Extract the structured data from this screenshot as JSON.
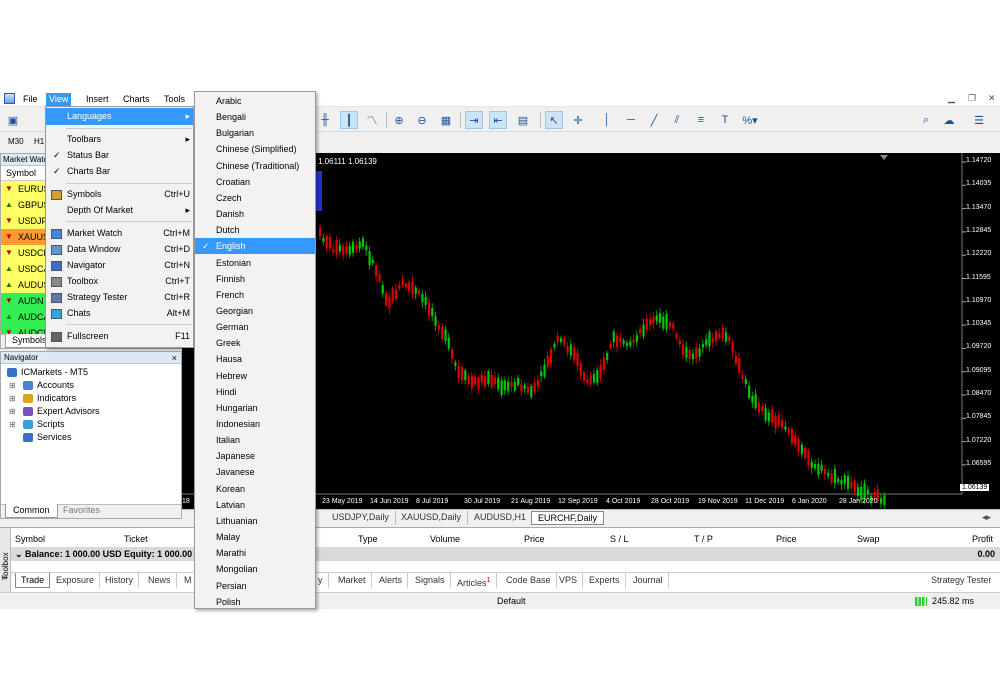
{
  "menubar": {
    "items": [
      "File",
      "View",
      "Insert",
      "Charts",
      "Tools"
    ],
    "active": "View"
  },
  "timeframes": [
    "M30",
    "H1"
  ],
  "market_watch": {
    "title": "Market Watch",
    "column_header": "Symbol",
    "symbols": [
      {
        "label": "EURUS",
        "color": "#ffff66",
        "dir": "down"
      },
      {
        "label": "GBPUS",
        "color": "#ffff66",
        "dir": "up"
      },
      {
        "label": "USDJPY",
        "color": "#ffff66",
        "dir": "down"
      },
      {
        "label": "XAUUS",
        "color": "#ff9933",
        "dir": "down"
      },
      {
        "label": "USDCH",
        "color": "#ffff66",
        "dir": "down"
      },
      {
        "label": "USDCA",
        "color": "#ffff66",
        "dir": "up"
      },
      {
        "label": "AUDUS",
        "color": "#ffff66",
        "dir": "up"
      },
      {
        "label": "AUDN",
        "color": "#33ee55",
        "dir": "down"
      },
      {
        "label": "AUDCA",
        "color": "#33ee55",
        "dir": "up"
      },
      {
        "label": "AUDCI",
        "color": "#33ee55",
        "dir": "down"
      }
    ],
    "tab": "Symbols"
  },
  "navigator": {
    "title": "Navigator",
    "close": "×",
    "root": "ICMarkets - MT5",
    "items": [
      "Accounts",
      "Indicators",
      "Expert Advisors",
      "Scripts",
      "Services"
    ],
    "tabs": [
      "Common",
      "Favorites"
    ]
  },
  "view_menu": {
    "items": [
      {
        "label": "Languages",
        "shortcut": "▸",
        "highlight": true
      },
      {
        "label": "Toolbars",
        "shortcut": "▸"
      },
      {
        "label": "Status Bar",
        "check": "✓"
      },
      {
        "label": "Charts Bar",
        "check": "✓"
      },
      {
        "label": "Symbols",
        "shortcut": "Ctrl+U",
        "icon": "symbols"
      },
      {
        "label": "Depth Of Market",
        "shortcut": "▸"
      },
      {
        "label": "Market Watch",
        "shortcut": "Ctrl+M",
        "icon": "market-watch"
      },
      {
        "label": "Data Window",
        "shortcut": "Ctrl+D",
        "icon": "data-window"
      },
      {
        "label": "Navigator",
        "shortcut": "Ctrl+N",
        "icon": "navigator"
      },
      {
        "label": "Toolbox",
        "shortcut": "Ctrl+T",
        "icon": "toolbox"
      },
      {
        "label": "Strategy Tester",
        "shortcut": "Ctrl+R",
        "icon": "strategy-tester"
      },
      {
        "label": "Chats",
        "shortcut": "Alt+M",
        "icon": "chats"
      },
      {
        "label": "Fullscreen",
        "shortcut": "F11",
        "icon": "fullscreen"
      }
    ]
  },
  "languages": {
    "selected": "English",
    "check": "✓",
    "items": [
      "Arabic",
      "Bengali",
      "Bulgarian",
      "Chinese (Simplified)",
      "Chinese (Traditional)",
      "Croatian",
      "Czech",
      "Danish",
      "Dutch",
      "English",
      "Estonian",
      "Finnish",
      "French",
      "Georgian",
      "German",
      "Greek",
      "Hausa",
      "Hebrew",
      "Hindi",
      "Hungarian",
      "Indonesian",
      "Italian",
      "Japanese",
      "Javanese",
      "Korean",
      "Latvian",
      "Lithuanian",
      "Malay",
      "Marathi",
      "Mongolian",
      "Persian",
      "Polish"
    ]
  },
  "chart": {
    "info": "1.06111 1.06139",
    "current_price": "1.06139",
    "price_labels": [
      "1.14720",
      "1.14035",
      "1.13470",
      "1.12845",
      "1.12220",
      "1.11595",
      "1.10970",
      "1.10345",
      "1.09720",
      "1.09095",
      "1.08470",
      "1.07845",
      "1.07220",
      "1.06595"
    ],
    "date_labels": [
      "18",
      "23 May 2019",
      "14 Jun 2019",
      "8 Jul 2019",
      "30 Jul 2019",
      "21 Aug 2019",
      "12 Sep 2019",
      "4 Oct 2019",
      "28 Oct 2019",
      "19 Nov 2019",
      "11 Dec 2019",
      "6 Jan 2020",
      "28 Jan 2020"
    ],
    "colors": {
      "bull": "#00c800",
      "bear": "#e00000",
      "bg": "#000000"
    }
  },
  "chart_tabs": [
    "USDJPY,Daily",
    "XAUUSD,Daily",
    "AUDUSD,H1",
    "EURCHF,Daily"
  ],
  "chart_tab_active": "EURCHF,Daily",
  "toolbox": {
    "side_label": "Toolbox",
    "close": "×",
    "columns": [
      "Symbol",
      "Ticket",
      "Type",
      "Volume",
      "Price",
      "S / L",
      "T / P",
      "Price",
      "Swap",
      "Profit"
    ],
    "balance": "Balance: 1 000.00 USD  Equity: 1 000.00",
    "balance_profit": "0.00",
    "tabs": [
      "Trade",
      "Exposure",
      "History",
      "News",
      "M",
      "y",
      "Market",
      "Alerts",
      "Signals",
      "Articles",
      "Code Base",
      "VPS",
      "Experts",
      "Journal"
    ],
    "articles_badge": "1",
    "strategy_tester": "Strategy Tester"
  },
  "statusbar": {
    "profile": "Default",
    "ping": "245.82 ms"
  }
}
